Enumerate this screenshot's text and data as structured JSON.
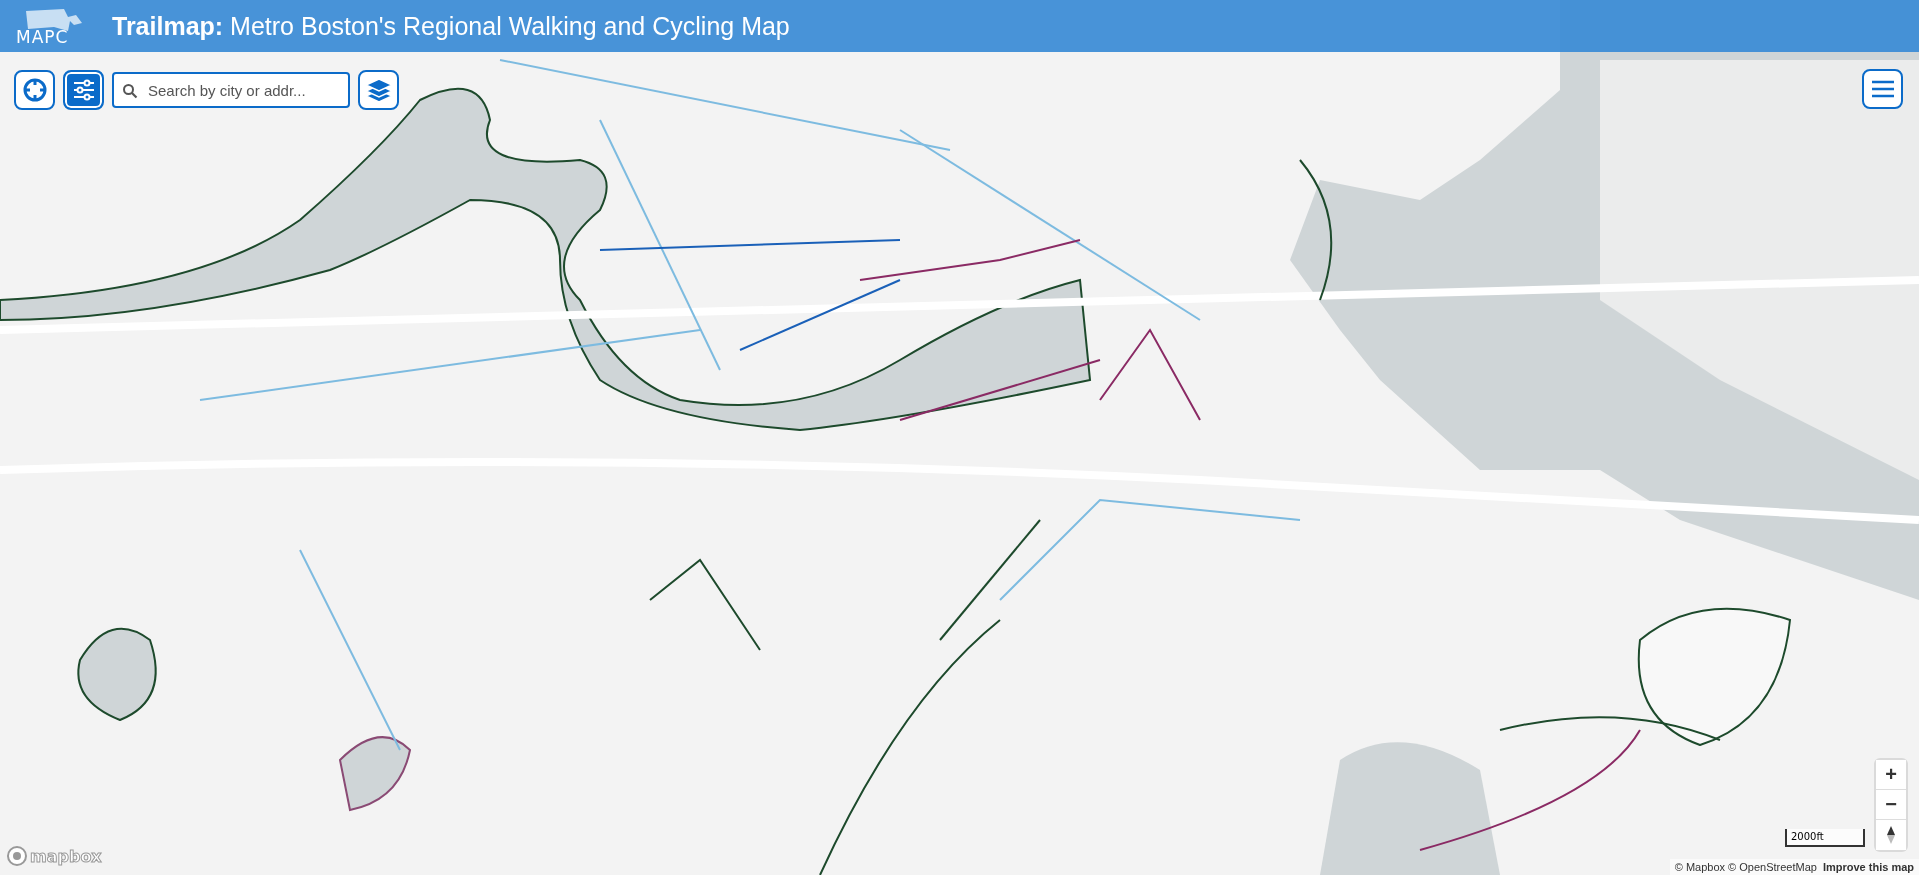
{
  "header": {
    "logo_text": "MAPC",
    "title": "**Trailmap:** Metro Boston's Regional Walking and Cycling Map"
  },
  "toolbar": {
    "search": {
      "placeholder": "Search by city or addr..."
    }
  },
  "map_controls": {
    "zoom_in": "+",
    "zoom_out": "−",
    "scale": "2000ft"
  },
  "attribution": {
    "text": "© Mapbox © OpenStreetMap",
    "link": "Improve this map",
    "logo_text": "mapbox"
  }
}
